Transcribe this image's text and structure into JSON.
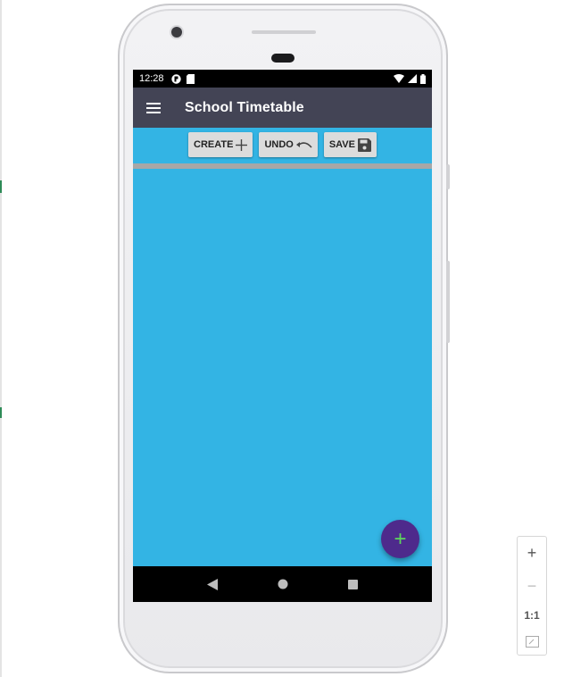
{
  "status_bar": {
    "time": "12:28"
  },
  "app_bar": {
    "title": "School Timetable"
  },
  "toolbar": {
    "create_label": "CREATE",
    "undo_label": "UNDO",
    "save_label": "SAVE"
  },
  "fab": {
    "symbol": "+"
  },
  "zoom_controls": {
    "zoom_in": "+",
    "zoom_out": "−",
    "actual_size": "1:1"
  },
  "colors": {
    "app_bar": "#434455",
    "content_background": "#33b4e4",
    "fab_background": "#4e2a8c",
    "fab_icon": "#5cd65c",
    "toolbar_button": "#dcdcdc"
  },
  "icons": {
    "menu": "hamburger-icon",
    "create": "plus-icon",
    "undo": "undo-icon",
    "save": "floppy-disk-icon",
    "nav_back": "triangle-back-icon",
    "nav_home": "circle-home-icon",
    "nav_recents": "square-recents-icon"
  }
}
